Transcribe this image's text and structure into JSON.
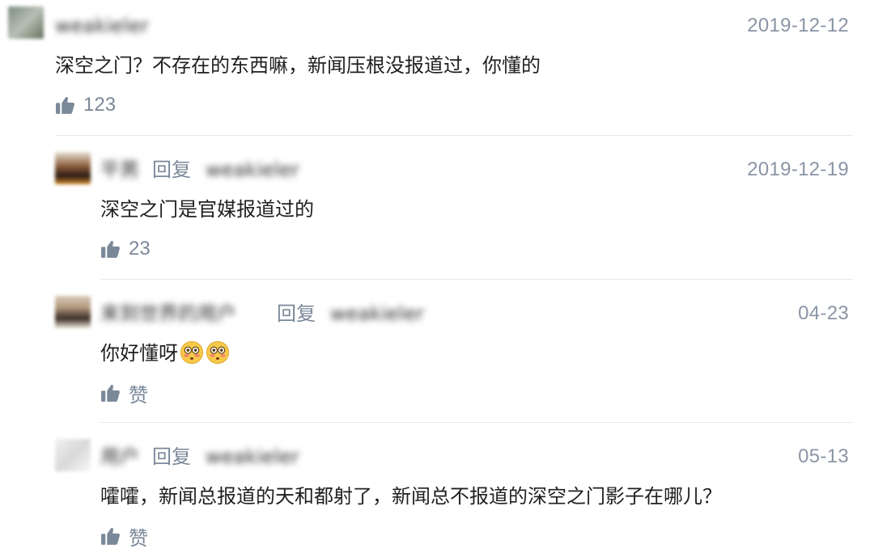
{
  "comments": [
    {
      "username": "weakieler",
      "date": "2019-12-12",
      "text": "深空之门？不存在的东西嘛，新闻压根没报道过，你懂的",
      "like_count": "123"
    },
    {
      "username": "平男",
      "reply_label": "回复",
      "reply_to": "weakieler",
      "date": "2019-12-19",
      "text": "深空之门是官媒报道过的",
      "like_count": "23"
    },
    {
      "username": "来到世界的用户",
      "reply_label": "回复",
      "reply_to": "weakieler",
      "date": "04-23",
      "text": "你好懂呀",
      "emoji": [
        "flushed-face",
        "flushed-face"
      ],
      "like_count": "赞"
    },
    {
      "username": "用户",
      "reply_label": "回复",
      "reply_to": "weakieler",
      "date": "05-13",
      "text": "嚯嚯，新闻总报道的天和都射了，新闻总不报道的深空之门影子在哪儿？",
      "like_count": "赞"
    }
  ],
  "colors": {
    "meta": "#8a95a5",
    "reply_word": "#7a8899",
    "thumb_icon": "#7a8899",
    "divider": "#e8e8e8"
  }
}
